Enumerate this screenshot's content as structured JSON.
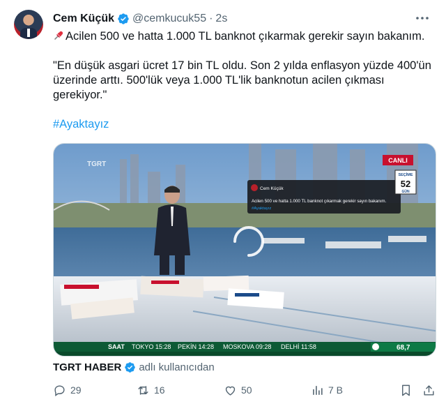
{
  "author": {
    "name": "Cem Küçük",
    "handle": "@cemkucuk55",
    "separator": "·",
    "time": "2s"
  },
  "tweet": {
    "line1": "Acilen 500 ve hatta 1.000 TL banknot çıkarmak gerekir sayın bakanım.",
    "quote": "\"En düşük asgari ücret 17 bin TL oldu. Son 2 yılda enflasyon yüzde 400'ün üzerinde arttı. 500'lük veya 1.000 TL'lik banknotun acilen çıkması gerekiyor.\"",
    "hashtag": "#Ayaktayız"
  },
  "video": {
    "channel_logo": "TGRT",
    "live_badge": "CANLI",
    "election_label": "SEÇİME",
    "election_days": "52",
    "election_unit": "GÜN",
    "screen_name": "Cem Küçük",
    "screen_text": "Acilen 500 ve hatta 1.000 TL banknot çıkarmak gerekir sayın bakanım.",
    "screen_hashtag": "#Ayaktayız",
    "ticker": {
      "label": "SAAT",
      "items": [
        "TOKYO 15:28",
        "PEKİN 14:28",
        "MOSKOVA 09:28",
        "DELHİ 11:58"
      ],
      "value": "68,7"
    }
  },
  "source": {
    "name": "TGRT HABER",
    "note": "adlı kullanıcıdan"
  },
  "actions": {
    "replies": "29",
    "retweets": "16",
    "likes": "50",
    "views": "7 B"
  },
  "colors": {
    "accent": "#1d9bf0",
    "muted": "#536471",
    "live": "#c8102e"
  },
  "icons": [
    "verified-badge-icon",
    "more-icon",
    "pushpin-icon",
    "reply-icon",
    "retweet-icon",
    "like-icon",
    "views-icon",
    "bookmark-icon",
    "share-icon"
  ]
}
